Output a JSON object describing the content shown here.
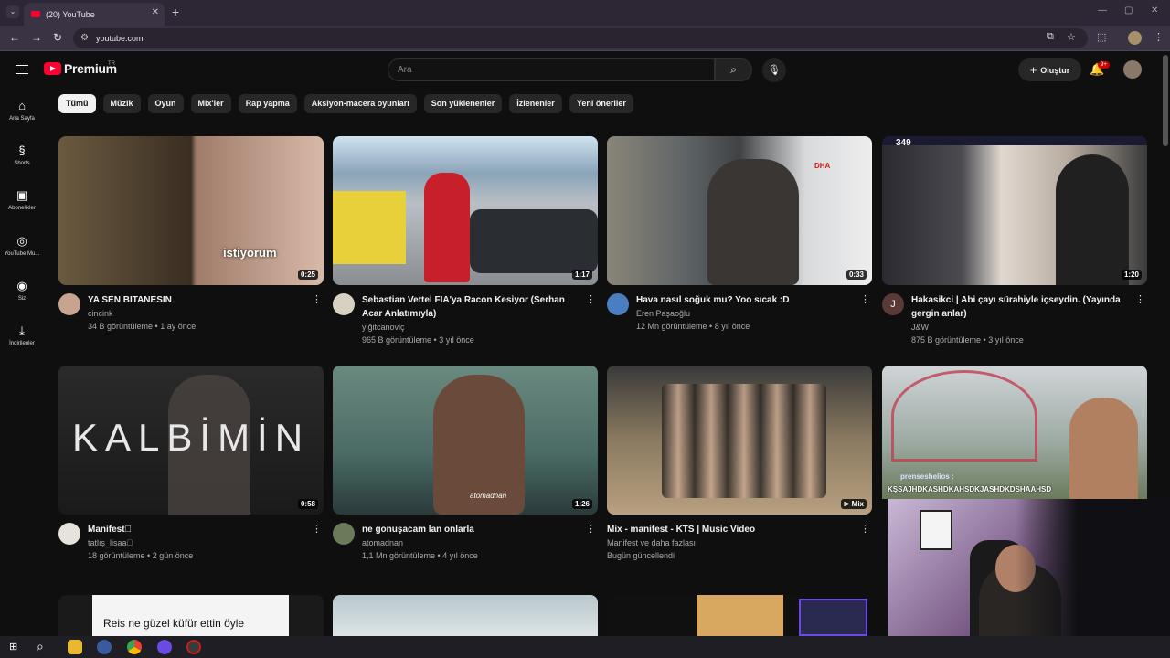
{
  "browser": {
    "tab_title": "(20) YouTube",
    "url": "youtube.com"
  },
  "header": {
    "logo_text": "Premium",
    "logo_region": "TR",
    "search_placeholder": "Ara",
    "create_label": "Oluştur",
    "notification_count": "9+"
  },
  "sidebar": {
    "items": [
      {
        "label": "Ana Sayfa",
        "icon": "home-icon"
      },
      {
        "label": "Shorts",
        "icon": "shorts-icon"
      },
      {
        "label": "Abonelikler",
        "icon": "subscriptions-icon"
      },
      {
        "label": "YouTube Mu...",
        "icon": "music-icon"
      },
      {
        "label": "Siz",
        "icon": "you-icon"
      },
      {
        "label": "İndirilenler",
        "icon": "download-icon"
      }
    ]
  },
  "chips": [
    "Tümü",
    "Müzik",
    "Oyun",
    "Mix'ler",
    "Rap yapma",
    "Aksiyon-macera oyunları",
    "Son yüklenenler",
    "İzlenenler",
    "Yeni öneriler"
  ],
  "videos": [
    {
      "title": "YA SEN BITANESIN",
      "title2": "",
      "channel": "cincink",
      "stats": "34 B görüntüleme • 1 ay önce",
      "duration": "0:25",
      "overlay": "istiyorum",
      "av_color": "#c7a48f"
    },
    {
      "title": "Sebastian Vettel FIA'ya Racon Kesiyor (Serhan",
      "title2": "Acar Anlatımıyla)",
      "channel": "yiğitcanoviç",
      "stats": "965 B görüntüleme • 3 yıl önce",
      "duration": "1:17",
      "overlay": "",
      "av_color": "#d8d0c0"
    },
    {
      "title": "Hava nasıl soğuk mu? Yoo sıcak :D",
      "title2": "",
      "channel": "Eren Paşaoğlu",
      "stats": "12 Mn görüntüleme • 8 yıl önce",
      "duration": "0:33",
      "overlay": "DHA",
      "av_color": "#4a7ec0"
    },
    {
      "title": "Hakasikci | Abi çayı sürahiyle içseydin. (Yayında",
      "title2": "gergin anlar)",
      "channel": "J&W",
      "stats": "875 B görüntüleme • 3 yıl önce",
      "duration": "1:20",
      "overlay": "349",
      "av_color": "#5a3a36",
      "av_letter": "J"
    },
    {
      "title": "Manifest⃝",
      "title2": "",
      "channel": "tatlış_lisaa⃝",
      "stats": "18 görüntüleme • 2 gün önce",
      "duration": "0:58",
      "overlay": "KALBİMİN",
      "av_color": "#e6e2dc"
    },
    {
      "title": "ne gonuşacam lan onlarla",
      "title2": "",
      "channel": "atomadnan",
      "stats": "1,1 Mn görüntüleme • 4 yıl önce",
      "duration": "1:26",
      "overlay": "atomadnan",
      "av_color": "#6a7a5a"
    },
    {
      "title": "Mix - manifest - KTS | Music Video",
      "title2": "",
      "channel": "Manifest ve daha fazlası",
      "stats": "Bugün güncellendi",
      "duration": "Mix",
      "overlay": "",
      "av_color": ""
    },
    {
      "title": "",
      "title2": "",
      "channel": "",
      "stats": "",
      "duration": "",
      "overlay": "KŞSAJHDKASHDKAHSDKJASHDKDSHAAHSD",
      "overlay2": "prenseshelios :",
      "av_color": ""
    }
  ],
  "bottom_row": {
    "caption": "Reis ne güzel küfür ettin öyle"
  },
  "colors": {
    "brand_red": "#ff0033",
    "background": "#0f0f0f",
    "chip_bg": "#272727"
  }
}
